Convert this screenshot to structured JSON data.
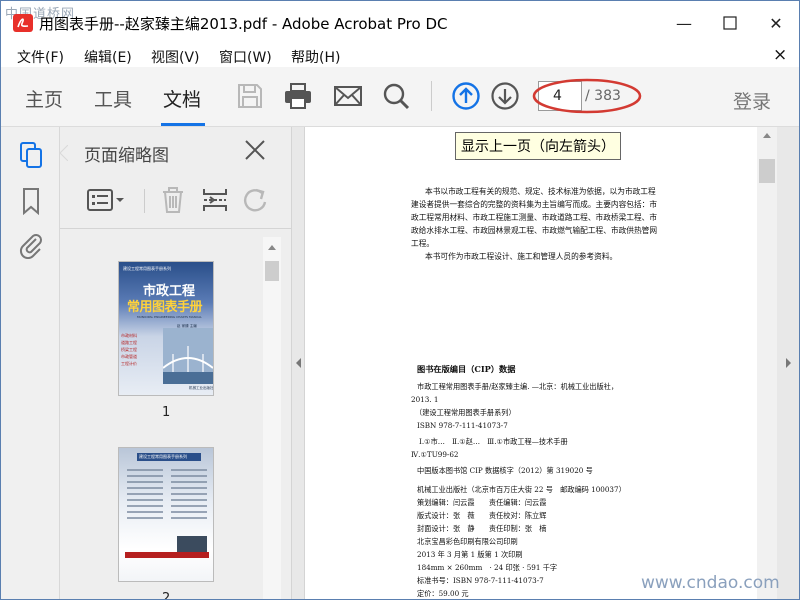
{
  "window": {
    "title": "用图表手册--赵家臻主编2013.pdf - Adobe Acrobat Pro DC",
    "minimize_label": "—",
    "close_label": "✕",
    "watermark_top_left": "中国道桥网",
    "watermark_bottom_right": "www.cndao.com"
  },
  "menu": {
    "items": [
      "文件(F)",
      "编辑(E)",
      "视图(V)",
      "窗口(W)",
      "帮助(H)"
    ],
    "close_label": "×"
  },
  "toolbar": {
    "tabs": [
      "主页",
      "工具",
      "文档"
    ],
    "active_tab": "文档",
    "icons": [
      "save-icon",
      "print-icon",
      "email-icon",
      "search-icon",
      "previous-page-icon",
      "next-page-icon"
    ],
    "current_page": "4",
    "total_pages": "/ 383",
    "login_label": "登录",
    "accent_color": "#1473e6",
    "highlight_color": "#d33a32"
  },
  "tooltip": {
    "text": "显示上一页（向左箭头）"
  },
  "rail": {
    "icons": [
      "page-thumbnails-icon",
      "bookmark-icon",
      "attachment-icon"
    ]
  },
  "panel": {
    "title": "页面缩略图",
    "tools": [
      "thumbnail-options-icon",
      "delete-icon",
      "insert-page-icon",
      "rotate-icon"
    ],
    "thumbnails": [
      {
        "label": "1",
        "series": "建设工程常用图表手册系列",
        "title_line1": "市政工程",
        "title_line2": "常用图表手册",
        "subtitle": "MUNICIPAL ENGINEERING CHARTS MANUAL",
        "editor": "赵 家臻 主编",
        "bullets": [
          "市政材料",
          "道路工程",
          "桥梁工程",
          "市政管道",
          "工程计价"
        ],
        "publisher": "机械工业出版社"
      },
      {
        "label": "2",
        "series": "建设工程常用图表手册系列"
      }
    ]
  },
  "document": {
    "intro": [
      "本书以市政工程有关的规范、规定、技术标准为依据，以为市政工程",
      "建设者提供一套综合的完整的资料集为主旨编写而成。主要内容包括：市",
      "政工程常用材料、市政工程施工测量、市政道路工程、市政桥梁工程、市",
      "政给水排水工程、市政园林景观工程、市政燃气输配工程、市政供热管网",
      "工程。",
      "本书可作为市政工程设计、施工和管理人员的参考资料。"
    ],
    "cip_heading": "图书在版编目（CIP）数据",
    "cip": [
      "市政工程常用图表手册/赵家臻主编. —北京：机械工业出版社，",
      "2013. 1",
      "（建设工程常用图表手册系列）",
      "ISBN 978-7-111-41073-7",
      "Ⅰ.①市…　Ⅱ.①赵…　Ⅲ.①市政工程—技术手册",
      "Ⅳ.①TU99-62",
      "中国版本图书馆 CIP 数据核字（2012）第 319020 号"
    ],
    "publisher": [
      "机械工业出版社（北京市百万庄大街 22 号　邮政编码 100037）",
      "策划编辑：闫云霞　　责任编辑：闫云霞",
      "版式设计：张　薇　　责任校对：陈立辉",
      "封面设计：张　静　　责任印制：张　楠",
      "北京宝昌彩色印刷有限公司印刷",
      "2013 年 3 月第 1 版第 1 次印刷",
      "184mm × 260mm　· 24 印张 · 591 千字",
      "标准书号：ISBN 978-7-111-41073-7",
      "定价：59.00 元"
    ]
  }
}
